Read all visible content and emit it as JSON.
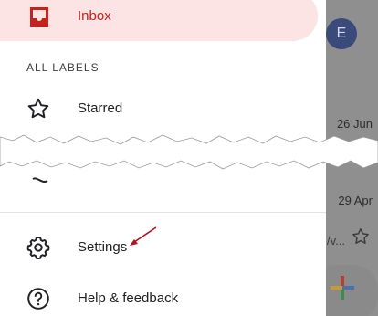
{
  "background": {
    "avatar_letter": "E",
    "dates": [
      "26 Jun",
      "29 Apr"
    ],
    "snippet": "/v..."
  },
  "drawer": {
    "inbox_label": "Inbox",
    "section_heading": "ALL LABELS",
    "starred_label": "Starred",
    "settings_label": "Settings",
    "help_label": "Help & feedback"
  },
  "colors": {
    "accent": "#c5221f",
    "selected_bg": "#fbe4e3"
  }
}
